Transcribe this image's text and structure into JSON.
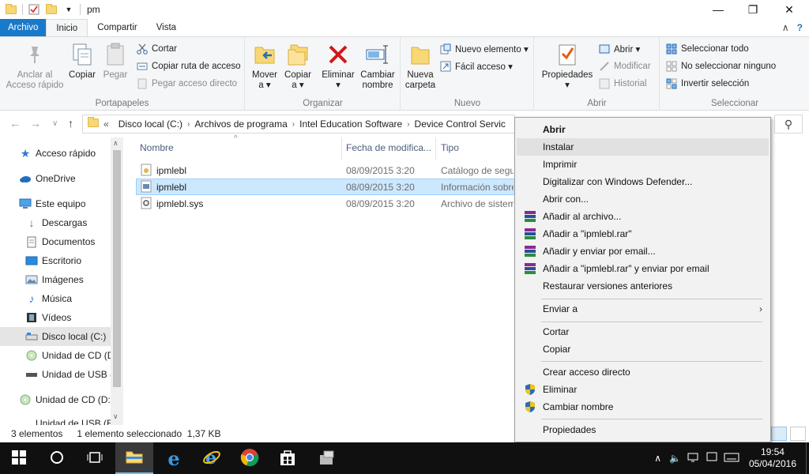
{
  "window": {
    "title": "pm",
    "minimize": "—",
    "maximize": "❐",
    "close": "✕"
  },
  "ribbon_tabs": [
    "Archivo",
    "Inicio",
    "Compartir",
    "Vista"
  ],
  "ribbon": {
    "portapapeles": {
      "label": "Portapapeles",
      "anclar": "Anclar al\nAcceso rápido",
      "copiar": "Copiar",
      "pegar": "Pegar",
      "cortar": "Cortar",
      "copiar_ruta": "Copiar ruta de acceso",
      "pegar_acceso": "Pegar acceso directo"
    },
    "organizar": {
      "label": "Organizar",
      "mover": "Mover\na ▾",
      "copiar_a": "Copiar\na ▾",
      "eliminar": "Eliminar\n▾",
      "cambiar": "Cambiar\nnombre"
    },
    "nuevo": {
      "label": "Nuevo",
      "nueva_carpeta": "Nueva\ncarpeta",
      "nuevo_elemento": "Nuevo elemento ▾",
      "facil_acceso": "Fácil acceso ▾"
    },
    "abrir": {
      "label": "Abrir",
      "propiedades": "Propiedades\n▾",
      "abrir": "Abrir ▾",
      "modificar": "Modificar",
      "historial": "Historial"
    },
    "seleccionar": {
      "label": "Seleccionar",
      "todo": "Seleccionar todo",
      "ninguno": "No seleccionar ninguno",
      "invertir": "Invertir selección"
    }
  },
  "address": {
    "prefix": "«",
    "crumbs": [
      "Disco local (C:)",
      "Archivos de programa",
      "Intel Education Software",
      "Device Control Servic"
    ]
  },
  "nav": {
    "items": [
      {
        "label": "Acceso rápido"
      },
      {
        "label": "OneDrive"
      },
      {
        "label": "Este equipo"
      },
      {
        "label": "Descargas"
      },
      {
        "label": "Documentos"
      },
      {
        "label": "Escritorio"
      },
      {
        "label": "Imágenes"
      },
      {
        "label": "Música"
      },
      {
        "label": "Vídeos"
      },
      {
        "label": "Disco local (C:)"
      },
      {
        "label": "Unidad de CD (D"
      },
      {
        "label": "Unidad de USB ("
      },
      {
        "label": "Unidad de CD (D:)"
      },
      {
        "label": "Unidad de USB (E:"
      }
    ]
  },
  "columns": {
    "name": "Nombre",
    "date": "Fecha de modifica...",
    "type": "Tipo"
  },
  "files": [
    {
      "name": "ipmlebl",
      "date": "08/09/2015 3:20",
      "type": "Catálogo de segu"
    },
    {
      "name": "ipmlebl",
      "date": "08/09/2015 3:20",
      "type": "Información sobre"
    },
    {
      "name": "ipmlebl.sys",
      "date": "08/09/2015 3:20",
      "type": "Archivo de sistem"
    }
  ],
  "status": {
    "count": "3 elementos",
    "selected": "1 elemento seleccionado  1,37 KB"
  },
  "context_menu": {
    "items": [
      "Abrir",
      "Instalar",
      "Imprimir",
      "Digitalizar con Windows Defender...",
      "Abrir con...",
      "Añadir al archivo...",
      "Añadir a \"ipmlebl.rar\"",
      "Añadir y enviar por email...",
      "Añadir a \"ipmlebl.rar\" y enviar por email",
      "Restaurar versiones anteriores",
      "Enviar a",
      "Cortar",
      "Copiar",
      "Crear acceso directo",
      "Eliminar",
      "Cambiar nombre",
      "Propiedades"
    ]
  },
  "taskbar": {
    "time": "19:54",
    "date": "05/04/2016"
  },
  "colors": {
    "accent": "#1979ca",
    "selection": "#cce8ff",
    "taskbar": "#101010"
  }
}
